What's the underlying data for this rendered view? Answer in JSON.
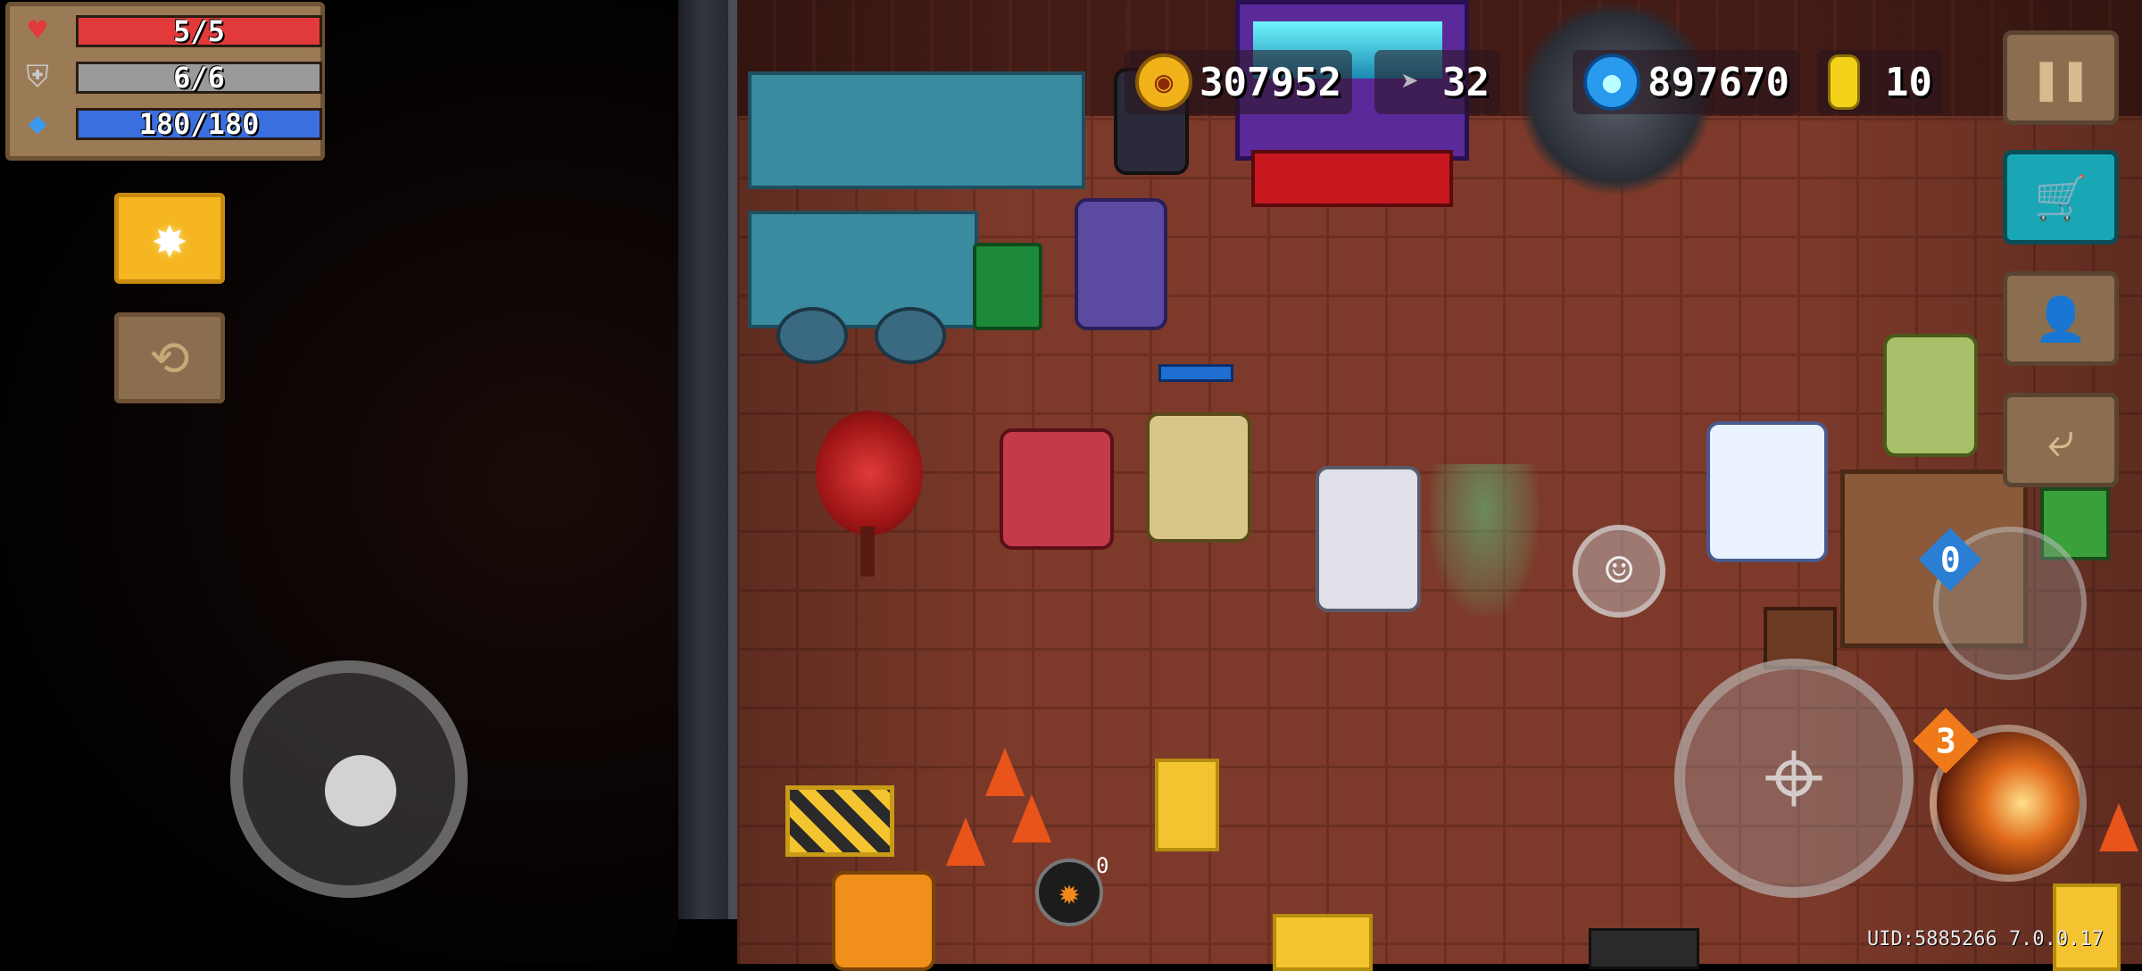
{
  "hud": {
    "health": {
      "label": "5/5",
      "current": 5,
      "max": 5,
      "color": "#e23a3a",
      "icon": "heart-icon"
    },
    "armor": {
      "label": "6/6",
      "current": 6,
      "max": 6,
      "color": "#9a9a9a",
      "icon": "shield-icon"
    },
    "energy": {
      "label": "180/180",
      "current": 180,
      "max": 180,
      "color": "#3a6fe0",
      "icon": "diamond-icon"
    }
  },
  "currencies": {
    "gold": {
      "value": "307952",
      "icon": "gold-coin-icon"
    },
    "fish": {
      "value": "32",
      "icon": "fish-icon"
    },
    "gems": {
      "value": "897670",
      "icon": "blue-gem-icon"
    },
    "coins": {
      "value": "10",
      "icon": "coin-icon"
    }
  },
  "buttons": {
    "skill": {
      "icon": "star-icon",
      "glyph": "✸"
    },
    "swap_character": {
      "icon": "swap-icon",
      "glyph": "⟲"
    },
    "pause": {
      "icon": "pause-icon",
      "glyph": "❚❚"
    },
    "shop": {
      "icon": "cart-icon",
      "glyph": "🛒"
    },
    "profile": {
      "icon": "profile-icon",
      "glyph": "👤"
    },
    "exit": {
      "icon": "stairs-icon",
      "glyph": "⤶"
    },
    "emote": {
      "icon": "smile-icon",
      "glyph": "☺"
    },
    "attack": {
      "icon": "crosshair-icon",
      "glyph": "⌖"
    }
  },
  "weapon": {
    "badge": "0"
  },
  "fire_skill": {
    "badge": "3"
  },
  "grenade": {
    "count": "0"
  },
  "footer": {
    "uid": "UID:5885266 7.0.0.17"
  },
  "colors": {
    "floor": "#7d3a2a",
    "panel": "#9b7a56",
    "skill_gold": "#f5b622",
    "shop_teal": "#1aa7b5"
  }
}
